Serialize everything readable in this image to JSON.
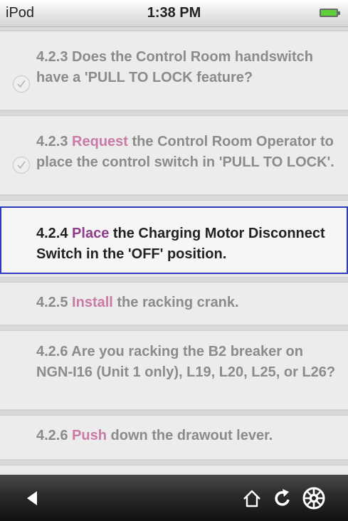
{
  "status_bar": {
    "carrier": "iPod",
    "time": "1:38 PM"
  },
  "steps": [
    {
      "num": "4.2.3",
      "before": " Does the Control Room handswitch have a 'PULL TO LOCK feature?",
      "verb": "",
      "after": "",
      "checked": true
    },
    {
      "num": "4.2.3",
      "before": " ",
      "verb": "Request",
      "after": " the Control Room Operator to place the control switch in 'PULL TO LOCK'.",
      "checked": true
    },
    {
      "num": "4.2.4",
      "before": " ",
      "verb": "Place",
      "after": " the Charging Motor Disconnect Switch in the 'OFF' position.",
      "checked": false,
      "active": true
    },
    {
      "num": "4.2.5",
      "before": " ",
      "verb": "Install",
      "after": " the racking crank.",
      "checked": false
    },
    {
      "num": "4.2.6",
      "before": " Are you racking the B2 breaker on NGN-I16 (Unit 1 only), L19, L20, L25, or L26?",
      "verb": "",
      "after": "",
      "checked": false
    },
    {
      "num": "4.2.6",
      "before": " ",
      "verb": "Push",
      "after": " down the drawout lever.",
      "checked": false
    }
  ],
  "toolbar": {
    "icons": [
      "back-arrow-icon",
      "home-icon",
      "refresh-icon",
      "settings-wheel-icon"
    ]
  },
  "colors": {
    "active_border": "#2b3cbf",
    "verb_active": "#8e3d8c",
    "verb_inactive": "#c97ba5",
    "battery": "#5fcf3a"
  }
}
